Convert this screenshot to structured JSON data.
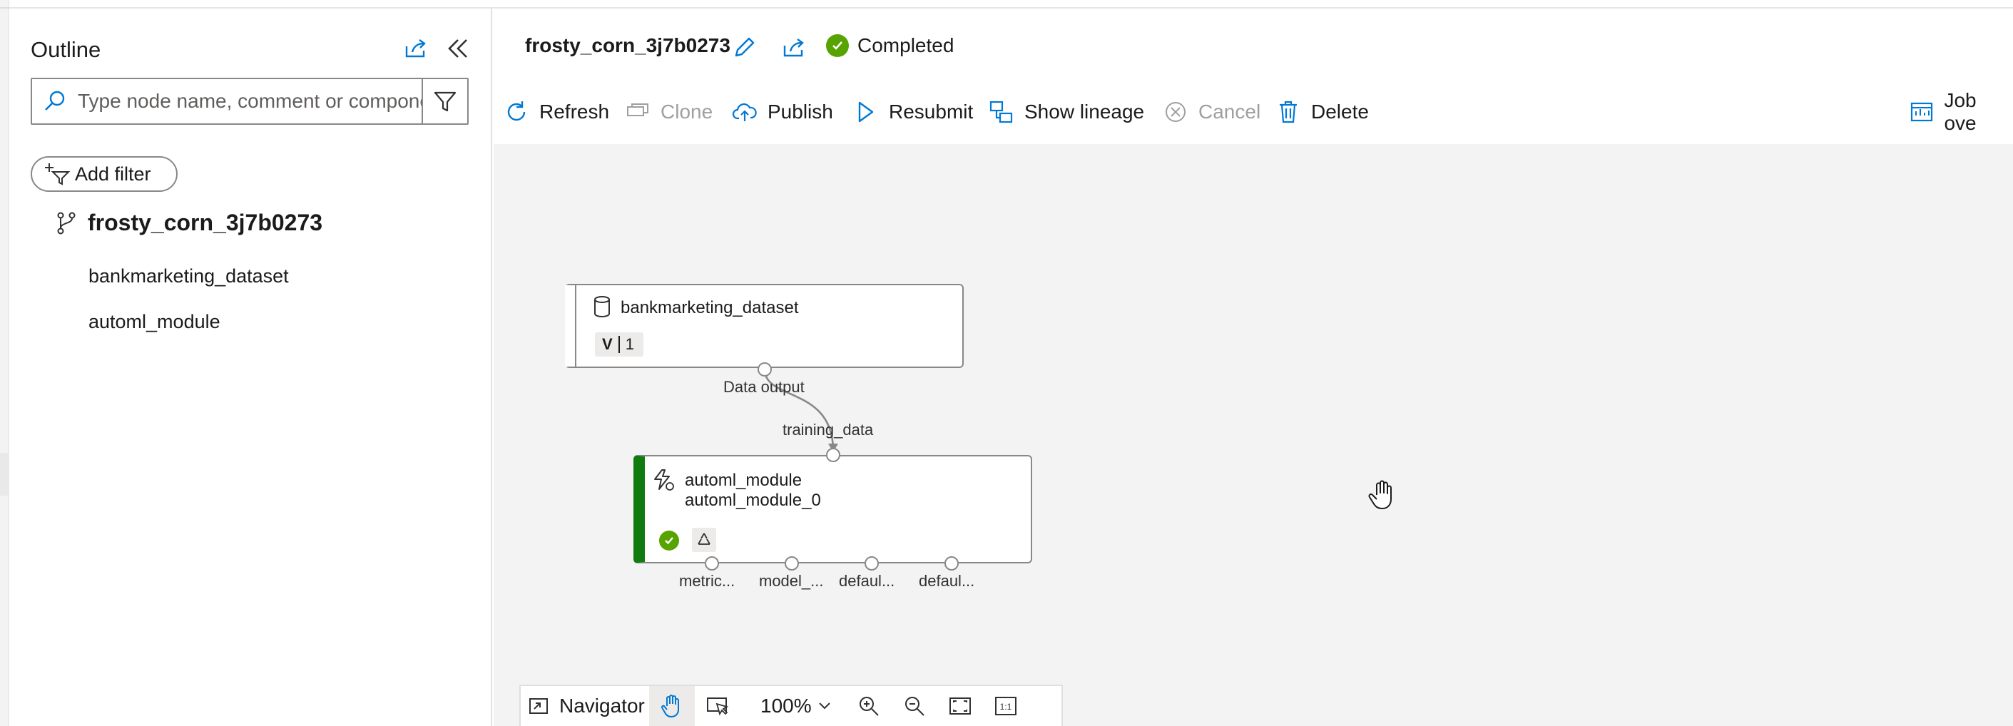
{
  "outline": {
    "title": "Outline",
    "search_placeholder": "Type node name, comment or component",
    "add_filter_label": "Add filter",
    "tree": {
      "root": "frosty_corn_3j7b0273",
      "items": [
        "bankmarketing_dataset",
        "automl_module"
      ]
    }
  },
  "header": {
    "job_name": "frosty_corn_3j7b0273",
    "status": "Completed"
  },
  "toolbar": {
    "refresh": "Refresh",
    "clone": "Clone",
    "publish": "Publish",
    "resubmit": "Resubmit",
    "show_lineage": "Show lineage",
    "cancel": "Cancel",
    "delete": "Delete",
    "job_overview": "Job ove"
  },
  "canvas": {
    "dataset_node": {
      "name": "bankmarketing_dataset",
      "version_letter": "V",
      "version": "1",
      "output_label": "Data output"
    },
    "module_node": {
      "name": "automl_module",
      "instance": "automl_module_0",
      "input_label": "training_data",
      "outputs": [
        "metric...",
        "model_...",
        "defaul...",
        "defaul..."
      ]
    }
  },
  "navigator": {
    "label": "Navigator",
    "zoom": "100%",
    "actual_size": "1:1"
  },
  "colors": {
    "success": "#57a300",
    "module_accent": "#107c10",
    "accent_blue": "#0078d4"
  }
}
